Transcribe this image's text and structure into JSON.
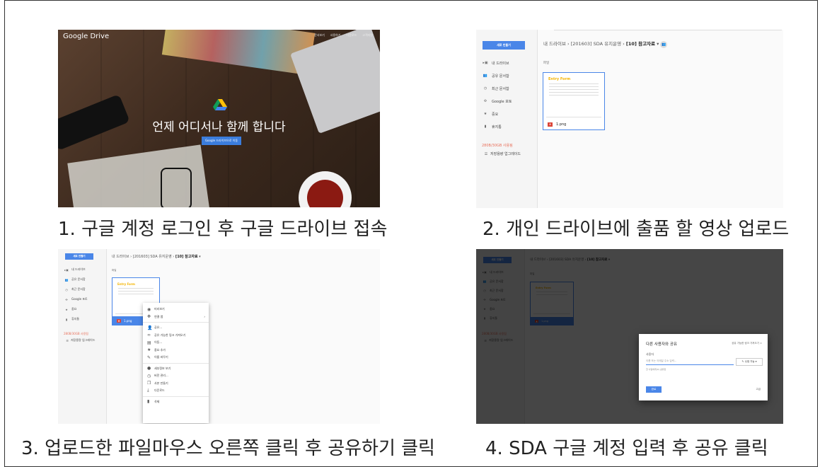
{
  "captions": {
    "step1": "1. 구글 계정 로그인 후 구글 드라이브 접속",
    "step2": "2. 개인 드라이브에 출품 할 영상 업로드",
    "step3": "3. 업로드한 파일마우스 오른쪽 클릭 후 공유하기 클릭",
    "step4": "4. SDA 구글 계정 입력 후 공유 클릭"
  },
  "landing": {
    "brand": "Google Drive",
    "nav": [
      "문서보기",
      "사용하기",
      "다운로드",
      "고객지원"
    ],
    "headline": "언제 어디서나 함께 합니다",
    "cta": "Google 드라이브으로 이동"
  },
  "drive": {
    "new_button": "새로 만들기",
    "nav_items": [
      {
        "icon": "drive-icon",
        "label": "내 드라이브"
      },
      {
        "icon": "shared-icon",
        "label": "공유 문서함"
      },
      {
        "icon": "clock-icon",
        "label": "최근 문서함"
      },
      {
        "icon": "photos-icon",
        "label": "Google 포토"
      },
      {
        "icon": "star-icon",
        "label": "중요"
      },
      {
        "icon": "trash-icon",
        "label": "휴지통"
      }
    ],
    "breadcrumb_root": "내 드라이브",
    "breadcrumb_mid": "[201603] SDA 유지운영",
    "breadcrumb_current": "[10] 참고자료",
    "files_label": "파일",
    "file_name": "1.png",
    "thumb_title": "Entry Form",
    "quota": "280B/30GB 사용됨",
    "upgrade": "저장용량 업그레이드"
  },
  "context_menu": [
    {
      "icon": "eye-icon",
      "label": "미리보기"
    },
    {
      "icon": "open-with-icon",
      "label": "연결 앱"
    },
    {
      "icon": "share-icon",
      "label": "공유..."
    },
    {
      "icon": "link-icon",
      "label": "공유 가능한 링크 가져오기"
    },
    {
      "icon": "move-icon",
      "label": "이동..."
    },
    {
      "icon": "star-icon",
      "label": "중요 추가"
    },
    {
      "icon": "rename-icon",
      "label": "이름 바꾸기"
    },
    {
      "icon": "info-icon",
      "label": "세부정보 보기"
    },
    {
      "icon": "history-icon",
      "label": "버전 관리..."
    },
    {
      "icon": "copy-icon",
      "label": "사본 만들기"
    },
    {
      "icon": "download-icon",
      "label": "다운로드"
    },
    {
      "icon": "trash-icon",
      "label": "삭제"
    }
  ],
  "share_dialog": {
    "title": "다른 사용자와 공유",
    "link_label": "공유 가능한 링크 가져오기",
    "people_label": "사용자",
    "input_placeholder": "이름 또는 이메일 주소 입력...",
    "permission": "수정 가능",
    "hint": "한 사람에게(0) 공유함",
    "done_button": "완료",
    "advanced": "고급"
  }
}
